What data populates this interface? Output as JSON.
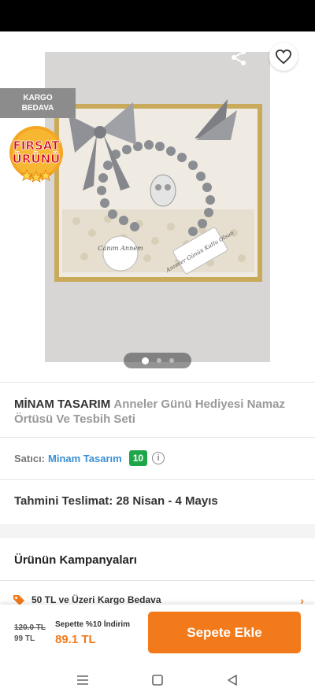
{
  "hero": {
    "badge_kargo": "KARGO\nBEDAVA",
    "badge_firsat_line1": "FIRSAT",
    "badge_firsat_line2": "ÜRÜNÜ",
    "photo_text_left": "Canım Annem",
    "photo_text_right": "Anneler Günün Kutlu Olsun",
    "slide_count": 3,
    "active_slide": 1
  },
  "product": {
    "brand": "MİNAM TASARIM",
    "name": "Anneler Günü Hediyesi Namaz Örtüsü Ve Tesbih Seti"
  },
  "seller": {
    "label": "Satıcı:",
    "name": "Minam Tasarım",
    "score": "10",
    "info_icon": "i"
  },
  "delivery": {
    "label": "Tahmini Teslimat:",
    "value": "28 Nisan - 4 Mayıs"
  },
  "campaigns": {
    "title": "Ürünün Kampanyaları",
    "items": [
      {
        "label": "50 TL ve Üzeri Kargo Bedava",
        "icon": "tag-icon"
      }
    ]
  },
  "bottom": {
    "old_price": "120.0 TL",
    "discounted_price": "99 TL",
    "basket_label": "Sepette %10 İndirim",
    "basket_price": "89.1 TL",
    "add_button": "Sepete Ekle"
  },
  "colors": {
    "accent": "#f27a1a",
    "seller_link": "#3c8fd4",
    "score_badge": "#1fa64a"
  }
}
